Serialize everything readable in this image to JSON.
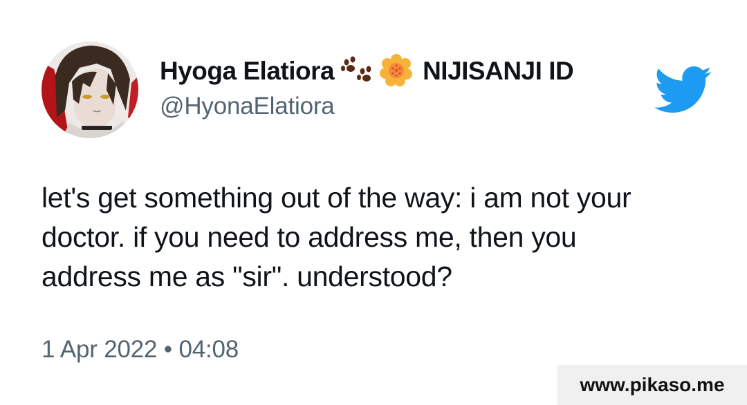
{
  "author": {
    "display_name": "Hyoga Elatiora",
    "badge_icons": [
      "paw-prints-icon",
      "blossom-icon"
    ],
    "affiliation": "NIJISANJI ID",
    "handle": "@HyonaElatiora",
    "avatar_icon": "avatar"
  },
  "tweet": {
    "text_lines": [
      "let's get something out of the way: i am not your",
      "doctor. if you need to address me, then you",
      "address me as \"sir\". understood?"
    ],
    "date": "1 Apr 2022",
    "separator": "•",
    "time": "04:08"
  },
  "brand": {
    "logo_icon": "twitter-bird-icon",
    "logo_color": "#1d9bf0"
  },
  "watermark": {
    "text": "www.pikaso.me"
  },
  "colors": {
    "primary_text": "#0f1419",
    "secondary_text": "#536471",
    "watermark_bg": "#f0f0f0"
  }
}
